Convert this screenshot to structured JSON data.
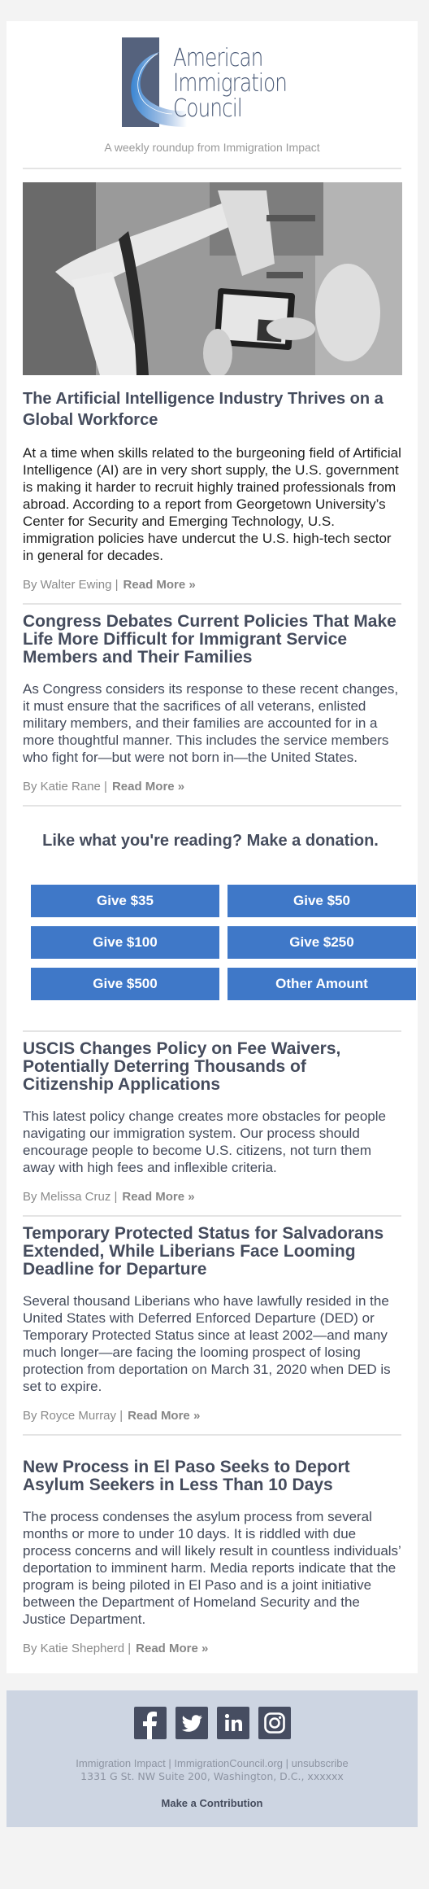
{
  "header": {
    "logo_lines": [
      "American",
      "Immigration",
      "Council"
    ],
    "tagline": "A weekly roundup from Immigration Impact"
  },
  "articles": [
    {
      "title": "The Artificial Intelligence Industry Thrives on a Global Workforce",
      "body": "At a time when skills related to the burgeoning field of Artificial Intelligence (AI) are in very short supply, the U.S. government is making it harder to recruit highly trained professionals from abroad. According to a report from Georgetown University’s Center for Security and Emerging Technology, U.S. immigration policies have undercut the U.S. high-tech sector in general for decades.",
      "byline": "By Walter Ewing |",
      "read_more": "Read More »"
    },
    {
      "title": "Congress Debates Current Policies That Make Life More Difficult for Immigrant Service Members and Their Families",
      "body": "As Congress considers its response to these recent changes, it must ensure that the sacrifices of all veterans, enlisted military members, and their families are accounted for in a more thoughtful manner. This includes the service members who fight for—but were not born in—the United States.",
      "byline": "By Katie Rane |",
      "read_more": "Read More »"
    },
    {
      "title": "USCIS Changes Policy on Fee Waivers, Potentially Deterring Thousands of Citizenship Applications",
      "body": "This latest policy change creates more obstacles for people navigating our immigration system. Our process should encourage people to become U.S. citizens, not turn them away with high fees and inflexible criteria.",
      "byline": "By Melissa Cruz |",
      "read_more": "Read More »"
    },
    {
      "title": "Temporary Protected Status for Salvadorans Extended, While Liberians Face Looming Deadline for Departure",
      "body": "Several thousand Liberians who have lawfully resided in the United States with Deferred Enforced Departure (DED) or Temporary Protected Status since at least 2002—and many much longer—are facing the looming prospect of losing protection from deportation on March 31, 2020 when DED is set to expire.",
      "byline": "By Royce Murray |",
      "read_more": "Read More »"
    },
    {
      "title": "New Process in El Paso Seeks to Deport Asylum Seekers in Less Than 10 Days",
      "body": "The process condenses the asylum process from several months or more to under 10 days. It is riddled with due process concerns and will likely result in countless individuals’ deportation to imminent harm. Media reports indicate that the program is being piloted in El Paso and is a joint initiative between the Department of Homeland Security and the Justice Department.",
      "byline": "By Katie Shepherd |",
      "read_more": "Read More »"
    }
  ],
  "donate": {
    "heading": "Like what you're reading? Make a donation.",
    "buttons": [
      "Give $35",
      "Give $50",
      "Give $100",
      "Give $250",
      "Give $500",
      "Other Amount"
    ],
    "button_color": "#3f78c8"
  },
  "footer": {
    "social": [
      "facebook-icon",
      "twitter-icon",
      "linkedin-icon",
      "instagram-icon"
    ],
    "link_impact": "Immigration Impact",
    "link_council": "ImmigrationCouncil.org",
    "link_unsubscribe": "unsubscribe",
    "separator": " | ",
    "address": "1331 G St. NW Suite 200, Washington, D.C., xxxxxx",
    "cta": "Make a Contribution"
  },
  "colors": {
    "page_bg": "#f3f3f3",
    "heading": "#454c5d",
    "footer_bg": "#cdd5e2",
    "social_bg": "#464d61",
    "logo_block": "#55627d"
  }
}
